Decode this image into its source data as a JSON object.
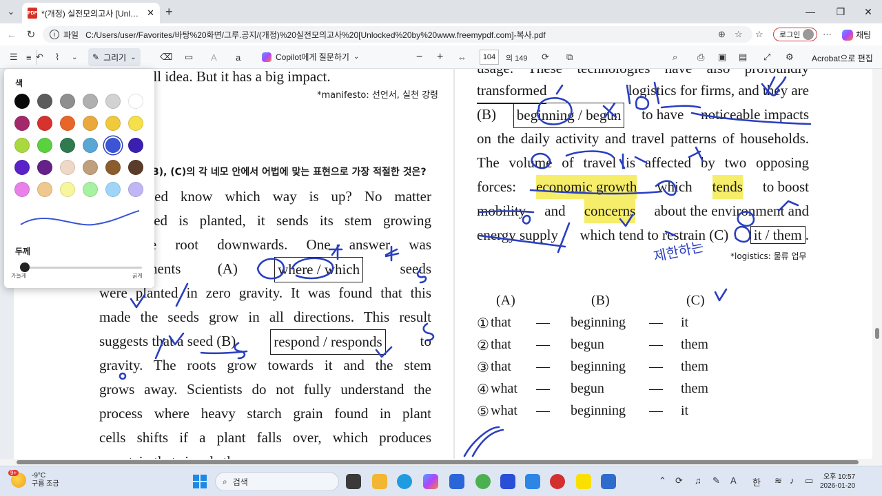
{
  "browser": {
    "tab_title": "*(개정) 실전모의고사 [Unlocked b",
    "address_scheme": "파일",
    "address_path": "C:/Users/user/Favorites/바탕%20화면/그루.공지/(개정)%20실전모의고사%20[Unlocked%20by%20www.freemypdf.com]-복사.pdf",
    "login_label": "로그인",
    "copilot_chat_label": "채팅"
  },
  "pdf_toolbar": {
    "draw_label": "그리기",
    "copilot_ask_label": "Copilot에게 질문하기",
    "page_current": "104",
    "page_total": "의 149",
    "acrobat_edit_label": "Acrobat으로 편집"
  },
  "color_panel": {
    "color_heading": "색",
    "thickness_heading": "두께",
    "thin_label": "가늘게",
    "thick_label": "굵게",
    "colors": [
      [
        "#0a0a0a",
        "#5c5c5c",
        "#8f8f8f",
        "#b0b0b0",
        "#d2d2d2",
        "#ffffff"
      ],
      [
        "#a32a6a",
        "#d6322e",
        "#e8662a",
        "#eaa93c",
        "#f0c93c",
        "#f5df4a"
      ],
      [
        "#a9d93f",
        "#5bd13f",
        "#2f7a4f",
        "#5aa7d5",
        "#3b55d6",
        "#3b1fb0"
      ],
      [
        "#5a22c8",
        "#65208a",
        "#efd8c6",
        "#bf9f7c",
        "#8b5c2e",
        "#5b3b2a"
      ],
      [
        "#ea80e9",
        "#eec88c",
        "#f8f69a",
        "#a6f2a0",
        "#9fd6f7",
        "#c1b6f5"
      ]
    ],
    "selected_color": "#3b55d6"
  },
  "left_column": {
    "top_line": "It's a small idea. But it has a big impact.",
    "footnote": "*manifesto: 선언서, 실천 강령",
    "question_fragment": "B), (C)의 각 네모 안에서 어법에 맞는 표현으로 가장 적절한 것은?",
    "l1": "es a seed know which way is up? No matter",
    "l2": "ay a seed is planted, it sends its stem growing",
    "l3": "and the root downwards. One answer was",
    "l4_pre": "n experiments",
    "l4_mark": "(A)",
    "l4_box": "where / which",
    "l4_post": "seeds",
    "l5": "were planted in zero gravity. It was found that this",
    "l6": "made the seeds grow in all directions. This result",
    "l7_pre": "suggests that a seed (B)",
    "l7_box": "respond / responds",
    "l7_post": "to",
    "l8": "gravity. The roots grow towards it and the stem",
    "l9": "grows away. Scientists do not fully understand the",
    "l10": "process where heavy starch grain found in plant",
    "l11": "cells shifts if a plant falls over, which produces",
    "l12": "a protein that signals the"
  },
  "right_column": {
    "r0": "usage. These technologies have also profoundly",
    "r1_a": "transformed",
    "r1_b": "logistics for firms, and they are",
    "r2_pre": "(B)",
    "r2_box": "beginning / begun",
    "r2_post_a": "to have",
    "r2_post_b": "noticeable impacts",
    "r3": "on the daily activity and travel patterns of households.",
    "r4": "The volume of travel is affected by two opposing",
    "r5_a": "forces:",
    "r5_hl1": "economic growth",
    "r5_b": "which",
    "r5_hl2": "tends",
    "r5_c": "to boost",
    "r6_a": "mobility",
    "r6_b": "and",
    "r6_hl": "concerns",
    "r6_c": "about the environment and",
    "r7_a": "energy supply",
    "r7_b": "which tend to restrain (C)",
    "r7_box": "it / them",
    "r7_end": ".",
    "footnote": "*logistics: 물류 업무",
    "handwriting": "제한하는"
  },
  "answers": {
    "headers": [
      "(A)",
      "(B)",
      "(C)"
    ],
    "dash": "—",
    "rows": [
      {
        "num": "①",
        "a": "that",
        "b": "beginning",
        "c": "it"
      },
      {
        "num": "②",
        "a": "that",
        "b": "begun",
        "c": "them"
      },
      {
        "num": "③",
        "a": "that",
        "b": "beginning",
        "c": "them"
      },
      {
        "num": "④",
        "a": "what",
        "b": "begun",
        "c": "them"
      },
      {
        "num": "⑤",
        "a": "what",
        "b": "beginning",
        "c": "it"
      }
    ]
  },
  "ink_color": "#2a3fbf",
  "taskbar": {
    "weather_temp": "-9°C",
    "weather_desc": "구름 조금",
    "weather_badge": "9+",
    "search_placeholder": "검색",
    "clock_time": "오후 10:57",
    "clock_date": "2026-01-20",
    "ime": "한",
    "font_a": "A"
  }
}
